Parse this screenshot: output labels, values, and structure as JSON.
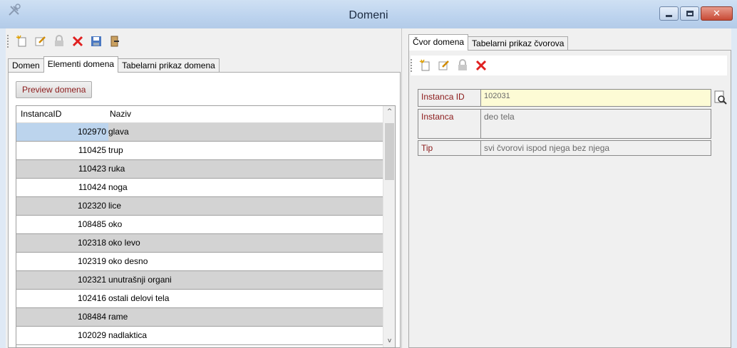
{
  "window": {
    "title": "Domeni",
    "icon": "tools-icon",
    "controls": [
      "minimize",
      "maximize",
      "close"
    ]
  },
  "left": {
    "toolbar": [
      "new-icon",
      "edit-icon",
      "lock-icon",
      "delete-icon",
      "save-icon",
      "exit-icon"
    ],
    "tabs": [
      "Domen",
      "Elementi domena",
      "Tabelarni prikaz domena"
    ],
    "active_tab": "Elementi domena",
    "preview_button": "Preview domena",
    "grid": {
      "columns": [
        "InstancaID",
        "Naziv"
      ],
      "rows": [
        {
          "id": "102970",
          "name": "glava"
        },
        {
          "id": "110425",
          "name": "trup"
        },
        {
          "id": "110423",
          "name": "ruka"
        },
        {
          "id": "110424",
          "name": "noga"
        },
        {
          "id": "102320",
          "name": "lice"
        },
        {
          "id": "108485",
          "name": "oko"
        },
        {
          "id": "102318",
          "name": "oko levo"
        },
        {
          "id": "102319",
          "name": "oko desno"
        },
        {
          "id": "102321",
          "name": "unutrašnji organi"
        },
        {
          "id": "102416",
          "name": "ostali delovi tela"
        },
        {
          "id": "108484",
          "name": "rame"
        },
        {
          "id": "102029",
          "name": "nadlaktica"
        }
      ],
      "scroll_up": "^",
      "scroll_down": "v"
    }
  },
  "right": {
    "tabs": [
      "Čvor domena",
      "Tabelarni prikaz čvorova"
    ],
    "active_tab": "Čvor domena",
    "toolbar": [
      "new-icon",
      "edit-icon",
      "lock-icon",
      "delete-icon"
    ],
    "form": {
      "instanca_id_label": "Instanca ID",
      "instanca_id_value": "102031",
      "instanca_label": "Instanca",
      "instanca_value": "deo tela",
      "tip_label": "Tip",
      "tip_value": "svi čvorovi ispod njega bez njega"
    }
  },
  "colors": {
    "title_bar": "#bcd3ee",
    "label_text": "#8b1a1a",
    "row_alt": "#d3d3d3",
    "row_selected": "#bcd4ed",
    "highlight_field": "#fdfbd5",
    "close_button": "#c84a35"
  }
}
